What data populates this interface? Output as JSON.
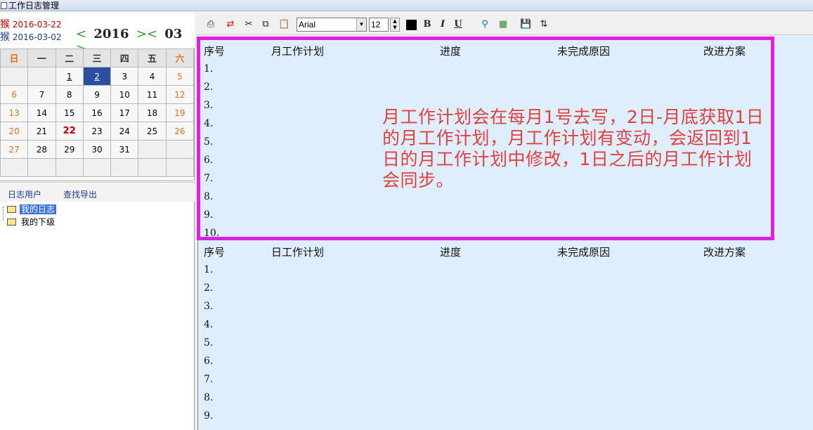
{
  "window": {
    "title": "工作日志管理"
  },
  "calendar": {
    "lunar_rows": [
      {
        "animal": "猴",
        "date": "2016-03-22"
      },
      {
        "animal": "猴",
        "date": "2016-03-02"
      }
    ],
    "nav": {
      "prev_year": "<",
      "year": "2016",
      "next_year": ">",
      "prev_month": "<",
      "month": "03",
      "next_month": ">"
    },
    "weekdays": [
      "日",
      "一",
      "二",
      "三",
      "四",
      "五",
      "六"
    ],
    "weeks": [
      [
        "",
        "",
        "1",
        "2",
        "3",
        "4",
        "5"
      ],
      [
        "6",
        "7",
        "8",
        "9",
        "10",
        "11",
        "12"
      ],
      [
        "13",
        "14",
        "15",
        "16",
        "17",
        "18",
        "19"
      ],
      [
        "20",
        "21",
        "22",
        "23",
        "24",
        "25",
        "26"
      ],
      [
        "27",
        "28",
        "29",
        "30",
        "31",
        "",
        ""
      ],
      [
        "",
        "",
        "",
        "",
        "",
        "",
        ""
      ]
    ],
    "selected_day": "2",
    "today": "22"
  },
  "left_nav": {
    "users": "日志用户",
    "export": "查找导出"
  },
  "tree": {
    "my_log": "我的日志",
    "my_subordinates": "我的下级"
  },
  "toolbar": {
    "font": "Arial",
    "font_size": "12",
    "bold": "B",
    "italic": "I",
    "underline": "U",
    "icons": [
      "print-icon",
      "replace-icon",
      "cut-icon",
      "copy-icon",
      "paste-icon",
      "color-icon",
      "bold-icon",
      "italic-icon",
      "underline-icon",
      "preview-icon",
      "export-icon",
      "save-icon",
      "sort-icon"
    ],
    "text_color": "#000000"
  },
  "monthly_table": {
    "headers": [
      "序号",
      "月工作计划",
      "进度",
      "未完成原因",
      "改进方案"
    ],
    "rows": [
      "1.",
      "2.",
      "3.",
      "4.",
      "5.",
      "6.",
      "7.",
      "8.",
      "9.",
      "10."
    ]
  },
  "daily_table": {
    "headers": [
      "序号",
      "日工作计划",
      "进度",
      "未完成原因",
      "改进方案"
    ],
    "rows": [
      "1.",
      "2.",
      "3.",
      "4.",
      "5.",
      "6.",
      "7.",
      "8.",
      "9."
    ]
  },
  "annotation": {
    "text": "月工作计划会在每月1号去写，2日-月底获取1日\n的月工作计划，月工作计划有变动，会返回到1\n日的月工作计划中修改，1日之后的月工作计划\n会同步。",
    "color": "#e04040",
    "highlight_color": "#e020e0"
  }
}
